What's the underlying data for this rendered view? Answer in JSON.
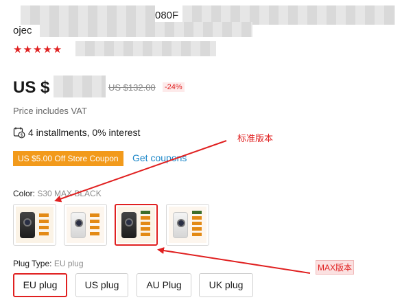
{
  "product": {
    "title_fragment_1": "080F",
    "title_fragment_2": "ojec",
    "rating_stars": "★★★★★"
  },
  "price": {
    "current": "US $",
    "original": "US $132.00",
    "discount": "-24%",
    "vat_note": "Price includes VAT"
  },
  "installments": {
    "text": "4 installments, 0% interest",
    "icon": "installment-icon"
  },
  "coupon": {
    "badge": "US $5.00 Off Store Coupon",
    "link": "Get coupons"
  },
  "color": {
    "label": "Color: ",
    "value": "S30 MAX BLACK",
    "options": [
      {
        "name": "black",
        "selected": false
      },
      {
        "name": "white",
        "selected": false
      },
      {
        "name": "black-max",
        "selected": true
      },
      {
        "name": "white-max",
        "selected": false
      }
    ]
  },
  "plug": {
    "label": "Plug Type: ",
    "value": "EU plug",
    "options": [
      "EU plug",
      "US plug",
      "AU Plug",
      "UK plug"
    ],
    "selected": "EU plug"
  },
  "annotations": {
    "standard_version": "标准版本",
    "max_version": "MAX版本",
    "color": "#e02020"
  }
}
